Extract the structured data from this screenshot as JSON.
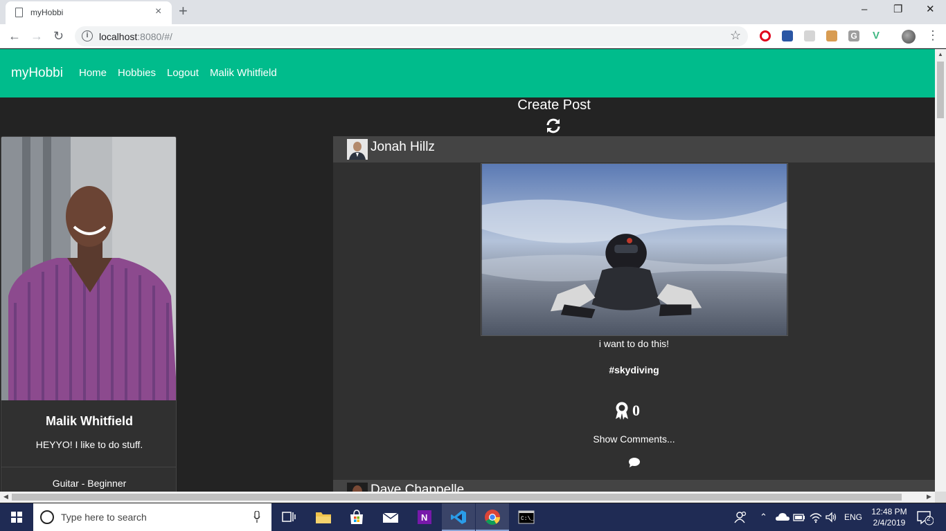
{
  "browser": {
    "tab_title": "myHobbi",
    "tab_close": "×",
    "new_tab": "+",
    "url_host": "localhost",
    "url_rest": ":8080/#/",
    "minimize": "–",
    "restore": "❐",
    "close": "✕"
  },
  "app": {
    "brand": "myHobbi",
    "nav": {
      "home": "Home",
      "hobbies": "Hobbies",
      "logout": "Logout",
      "user": "Malik Whitfield"
    },
    "create_post": "Create Post"
  },
  "profile": {
    "name": "Malik Whitfield",
    "bio": "HEYYO! I like to do stuff.",
    "hobby": "Guitar - Beginner"
  },
  "posts": [
    {
      "author": "Jonah Hillz",
      "caption": "i want to do this!",
      "tag": "#skydiving",
      "awards": "0",
      "show_comments": "Show Comments..."
    },
    {
      "author": "Dave Chappelle"
    }
  ],
  "taskbar": {
    "search_placeholder": "Type here to search",
    "language": "ENG",
    "time": "12:48 PM",
    "date": "2/4/2019",
    "notifications": "2"
  },
  "colors": {
    "brand_green": "#00bc8c",
    "page_bg": "#232323",
    "card_bg": "#303030",
    "taskbar": "#1f2b54"
  }
}
